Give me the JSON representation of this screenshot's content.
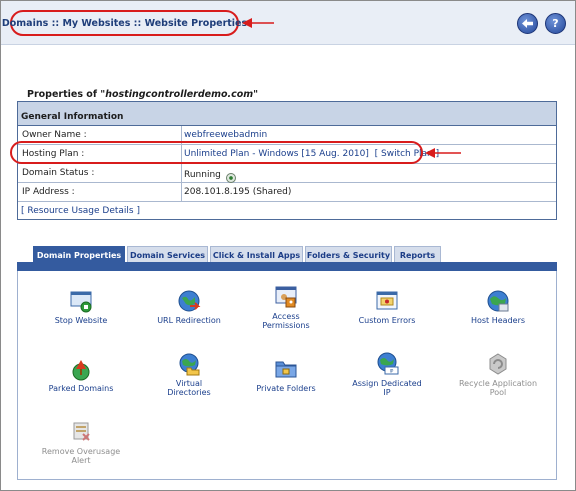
{
  "header": {
    "breadcrumb": "Domains :: My Websites :: Website Properties",
    "back_icon": "back-arrow-icon",
    "help_icon": "help-icon"
  },
  "properties": {
    "title_prefix": "Properties of ",
    "domain": "\"hostingcontrollerdemo.com\"",
    "section_header": "General Information",
    "rows": [
      {
        "label": "Owner Name :",
        "value": "webfreewebadmin"
      },
      {
        "label": "Hosting Plan :",
        "value": "Unlimited Plan - Windows [15 Aug. 2010]",
        "action": "[ Switch Plan ]"
      },
      {
        "label": "Domain Status :",
        "value": "Running"
      },
      {
        "label": "IP Address :",
        "value": "208.101.8.195 (Shared)"
      }
    ],
    "resource_link": "[ Resource Usage Details ]"
  },
  "tabs": [
    "Domain Properties",
    "Domain Services",
    "Click & Install Apps",
    "Folders & Security",
    "Reports"
  ],
  "active_tab": "Domain Properties",
  "tiles": [
    {
      "l1": "Stop Website",
      "l2": "",
      "icon": "stop-website-icon",
      "enabled": true
    },
    {
      "l1": "URL Redirection",
      "l2": "",
      "icon": "url-redirection-icon",
      "enabled": true
    },
    {
      "l1": "Access",
      "l2": "Permissions",
      "icon": "access-permissions-icon",
      "enabled": true
    },
    {
      "l1": "Custom Errors",
      "l2": "",
      "icon": "custom-errors-icon",
      "enabled": true
    },
    {
      "l1": "Host Headers",
      "l2": "",
      "icon": "host-headers-icon",
      "enabled": true
    },
    {
      "l1": "Parked Domains",
      "l2": "",
      "icon": "parked-domains-icon",
      "enabled": true
    },
    {
      "l1": "Virtual",
      "l2": "Directories",
      "icon": "virtual-directories-icon",
      "enabled": true
    },
    {
      "l1": "Private Folders",
      "l2": "",
      "icon": "private-folders-icon",
      "enabled": true
    },
    {
      "l1": "Assign Dedicated",
      "l2": "IP",
      "icon": "assign-dedicated-ip-icon",
      "enabled": true
    },
    {
      "l1": "Recycle Application",
      "l2": "Pool",
      "icon": "recycle-application-pool-icon",
      "enabled": false
    },
    {
      "l1": "Remove Overusage",
      "l2": "Alert",
      "icon": "remove-overusage-alert-icon",
      "enabled": false
    }
  ],
  "colors": {
    "highlight": "#d81c1c",
    "tab_active": "#345b9f",
    "link": "#1b3f8c"
  }
}
